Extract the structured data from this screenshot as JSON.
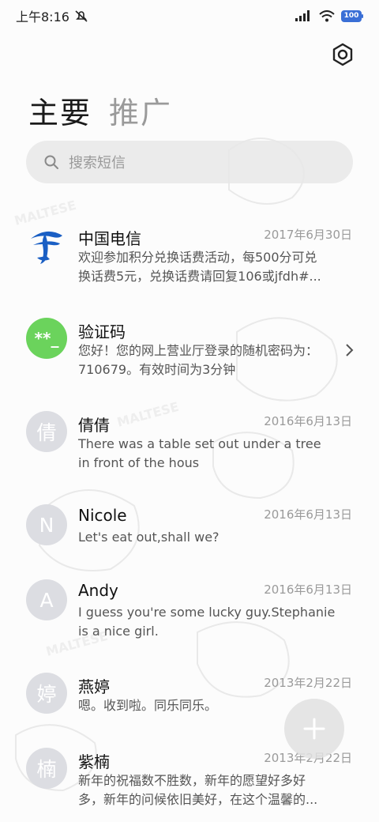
{
  "status_bar": {
    "time": "上午8:16",
    "battery": "100"
  },
  "tabs": [
    {
      "label": "主要",
      "active": true
    },
    {
      "label": "推广",
      "active": false
    }
  ],
  "search": {
    "placeholder": "搜索短信"
  },
  "conversations": [
    {
      "name": "中国电信",
      "date": "2017年6月30日",
      "preview_line1": "欢迎参加积分兑换话费活动，每500分可兑",
      "preview_line2": "换话费5元，兑换话费请回复106或jfdh#...",
      "avatar_type": "logo"
    },
    {
      "name": "验证码",
      "date": "",
      "preview_line1": "您好！您的网上营业厅登录的随机密码为：",
      "preview_line2": "710679。有效时间为3分钟",
      "avatar_text": "**_",
      "avatar_color": "#6bd35c"
    },
    {
      "name": "倩倩",
      "date": "2016年6月13日",
      "preview_line1": "There was a table set out under a tree",
      "preview_line2": "in front of the hous",
      "avatar_text": "倩"
    },
    {
      "name": "Nicole",
      "date": "2016年6月13日",
      "preview_line1": "Let's eat out,shall we?",
      "preview_line2": "",
      "avatar_text": "N"
    },
    {
      "name": "Andy",
      "date": "2016年6月13日",
      "preview_line1": "I guess you're some lucky guy.Stephanie",
      "preview_line2": "is a nice girl.",
      "avatar_text": "A"
    },
    {
      "name": "燕婷",
      "date": "2013年2月22日",
      "preview_line1": "嗯。收到啦。同乐同乐。",
      "preview_line2": "",
      "avatar_text": "婷"
    },
    {
      "name": "紫楠",
      "date": "2013年2月22日",
      "preview_line1": "新年的祝福数不胜数，新年的愿望好多好",
      "preview_line2": "多，新年的问候依旧美好，在这个温馨的...",
      "avatar_text": "楠"
    }
  ],
  "icons": {
    "settings": "hexagon-gear-icon",
    "search": "search-icon",
    "compose": "plus-icon",
    "chevron": "chevron-right-icon"
  }
}
